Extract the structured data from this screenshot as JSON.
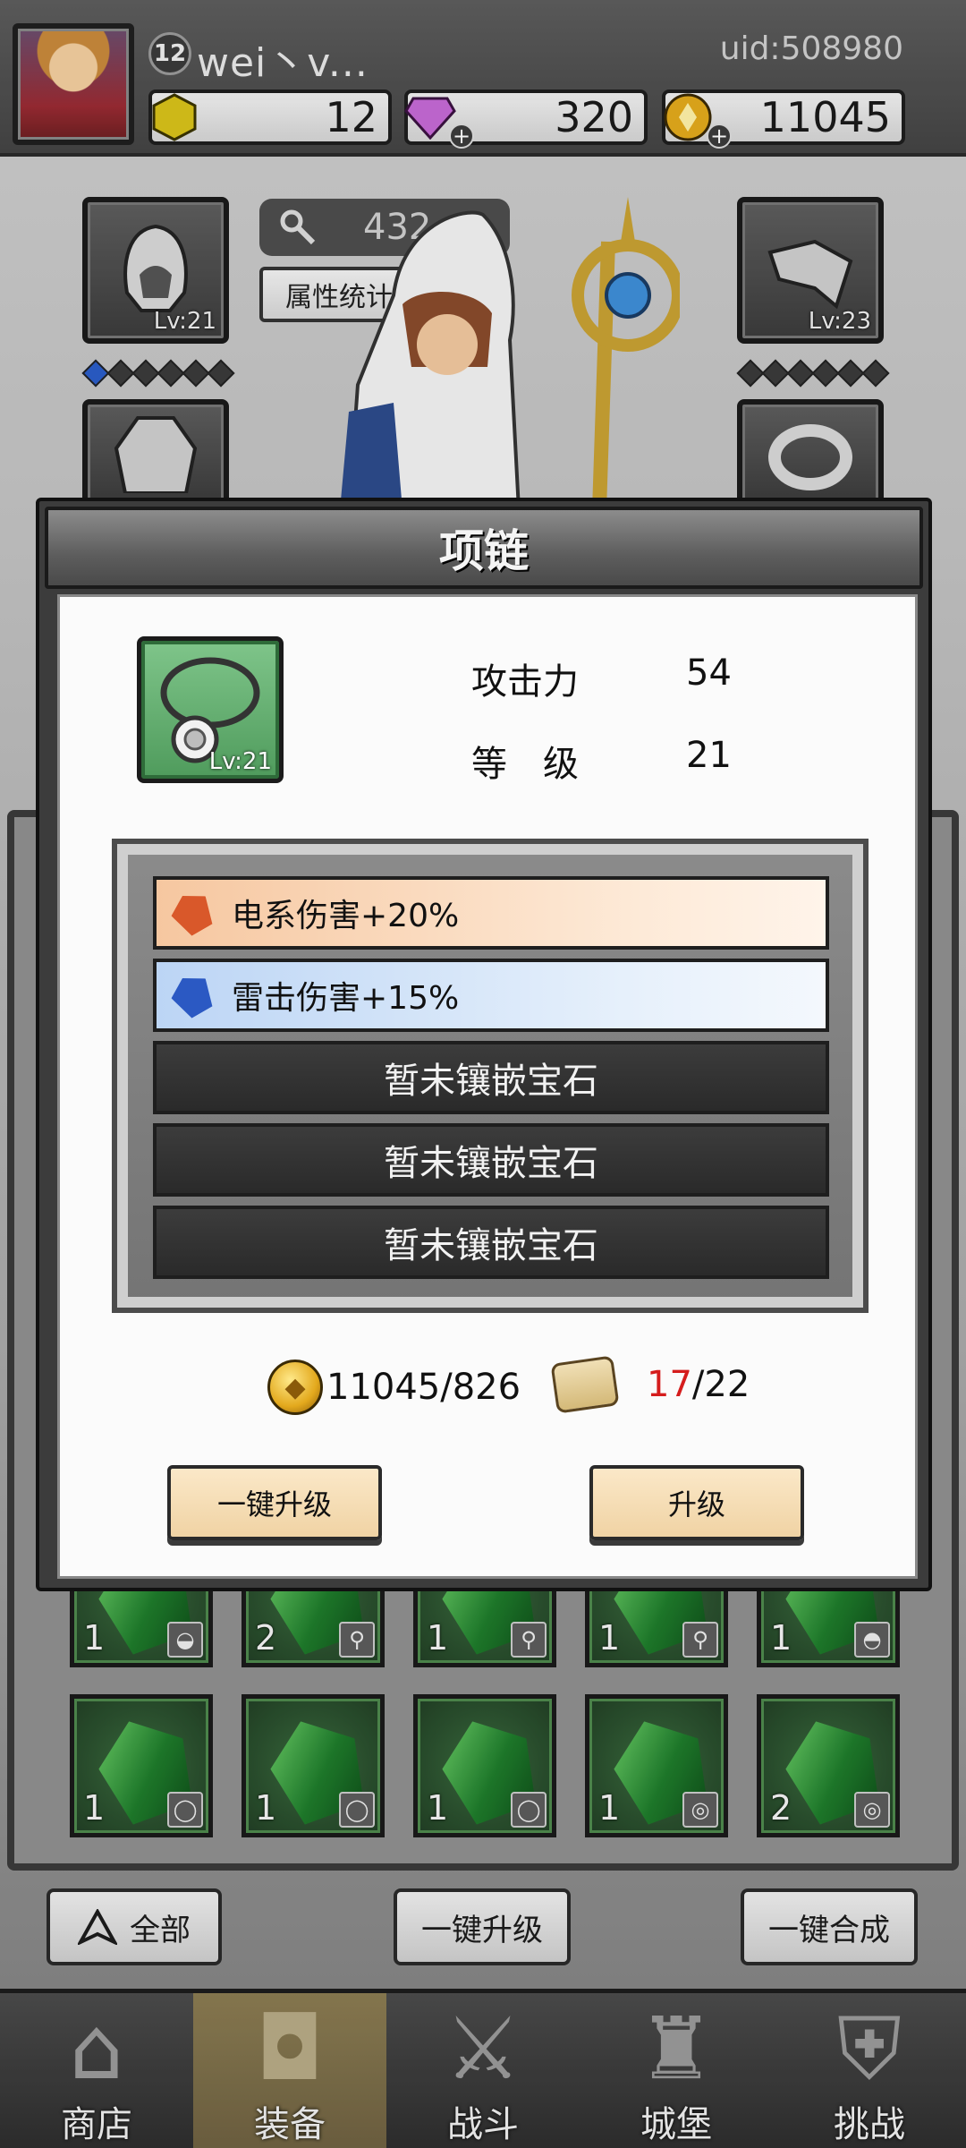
{
  "header": {
    "level": "12",
    "player_name": "wei丶v...",
    "uid": "uid:508980",
    "currencies": [
      {
        "name": "gold-gem",
        "value": "12"
      },
      {
        "name": "diamond",
        "value": "320"
      },
      {
        "name": "coin",
        "value": "11045"
      }
    ]
  },
  "equipment": {
    "power": "432",
    "stats_button": "属性统计",
    "left_top_slot": {
      "icon": "hood-icon",
      "level": "Lv:21"
    },
    "right_top_slot": {
      "icon": "bracer-icon",
      "level": "Lv:23"
    },
    "left_stars_on": 1,
    "right_stars_on": 0
  },
  "modal": {
    "title": "项链",
    "item_icon": "necklace-icon",
    "item_level": "Lv:21",
    "attack_label": "攻击力",
    "attack_value": "54",
    "grade_label": "等　级",
    "grade_value": "21",
    "gems": [
      {
        "type": "fire",
        "text": "电系伤害+20%",
        "color": "#d9582a"
      },
      {
        "type": "water",
        "text": "雷击伤害+15%",
        "color": "#2b59c3"
      },
      {
        "type": "empty",
        "text": "暂未镶嵌宝石"
      },
      {
        "type": "empty",
        "text": "暂未镶嵌宝石"
      },
      {
        "type": "empty",
        "text": "暂未镶嵌宝石"
      }
    ],
    "coin_cost": "11045/826",
    "scroll_have": "17",
    "scroll_need": "/22",
    "btn_one_click_upgrade": "一键升级",
    "btn_upgrade": "升级"
  },
  "inventory": {
    "row1_counts": [
      "1",
      "2",
      "1",
      "1",
      "1"
    ],
    "row2_counts": [
      "1",
      "1",
      "1",
      "1",
      "2"
    ]
  },
  "bottom_buttons": {
    "filter_all": "全部",
    "one_click_upgrade": "一键升级",
    "one_click_merge": "一键合成"
  },
  "nav": [
    {
      "label": "商店",
      "icon": "shop-icon"
    },
    {
      "label": "装备",
      "icon": "bag-icon"
    },
    {
      "label": "战斗",
      "icon": "swords-icon"
    },
    {
      "label": "城堡",
      "icon": "castle-icon"
    },
    {
      "label": "挑战",
      "icon": "challenge-icon"
    }
  ],
  "colors": {
    "accent_red": "#d51d1d",
    "button_cream": "#f0d3a4"
  }
}
